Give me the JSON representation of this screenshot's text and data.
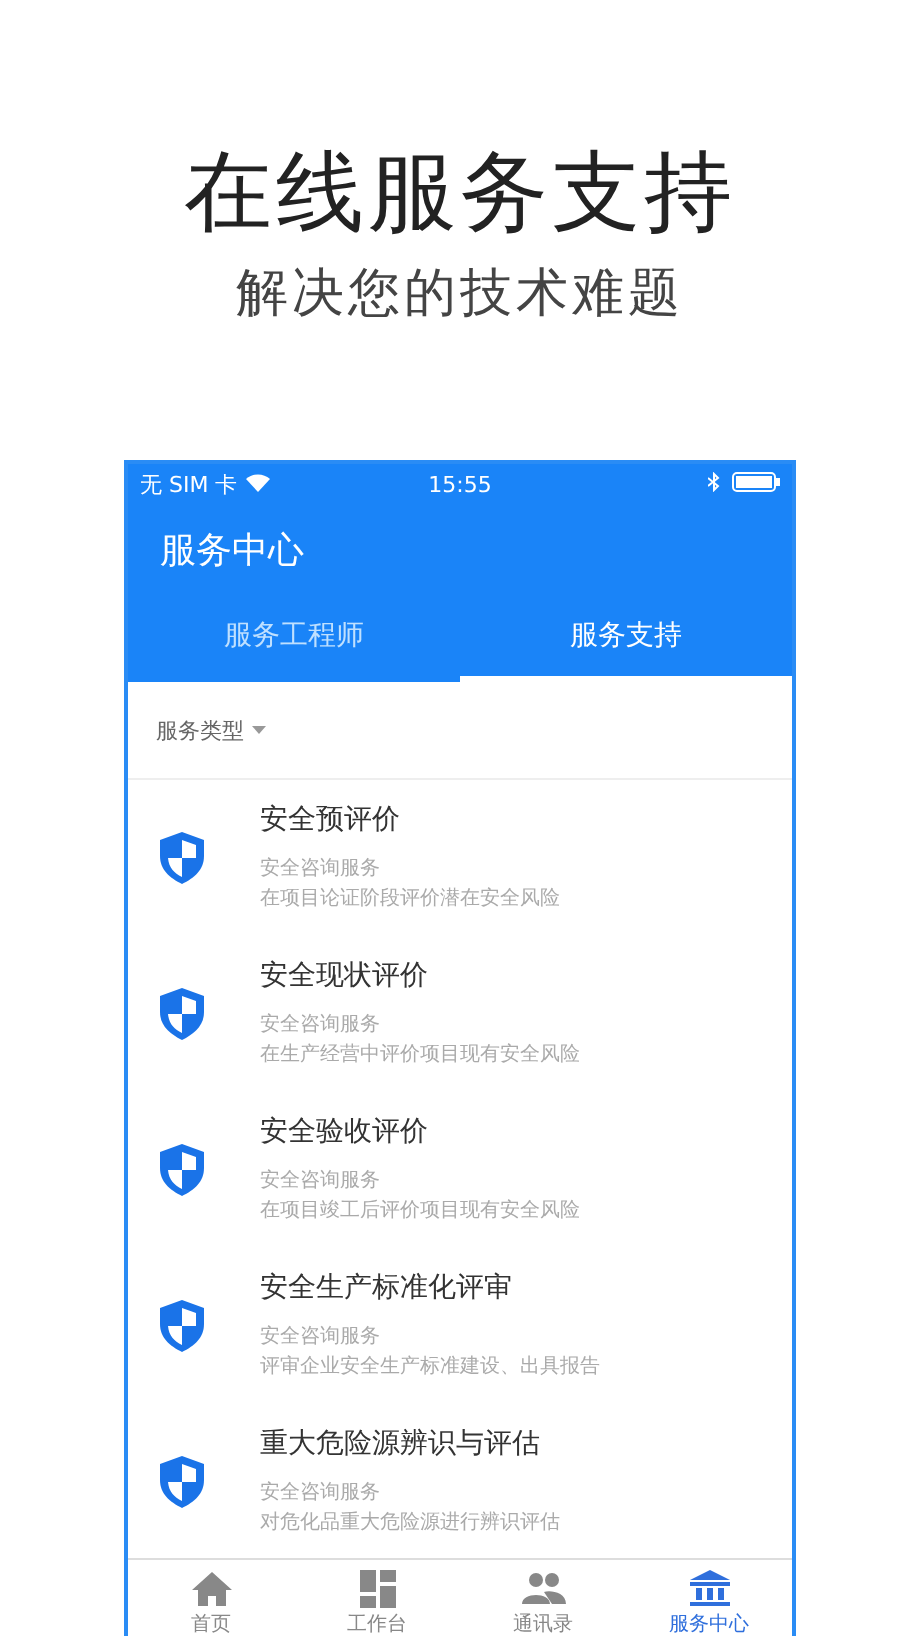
{
  "headline": "在线服务支持",
  "subheadline": "解决您的技术难题",
  "status_bar": {
    "carrier": "无 SIM 卡",
    "time": "15:55"
  },
  "header": {
    "title": "服务中心"
  },
  "tabs": [
    {
      "label": "服务工程师",
      "selected": false
    },
    {
      "label": "服务支持",
      "selected": true
    }
  ],
  "filter": {
    "label": "服务类型"
  },
  "services": [
    {
      "title": "安全预评价",
      "category": "安全咨询服务",
      "description": "在项目论证阶段评价潜在安全风险"
    },
    {
      "title": "安全现状评价",
      "category": "安全咨询服务",
      "description": "在生产经营中评价项目现有安全风险"
    },
    {
      "title": "安全验收评价",
      "category": "安全咨询服务",
      "description": "在项目竣工后评价项目现有安全风险"
    },
    {
      "title": "安全生产标准化评审",
      "category": "安全咨询服务",
      "description": "评审企业安全生产标准建设、出具报告"
    },
    {
      "title": "重大危险源辨识与评估",
      "category": "安全咨询服务",
      "description": "对危化品重大危险源进行辨识评估"
    }
  ],
  "bottom_nav": [
    {
      "kind": "home",
      "label": "首页",
      "selected": false
    },
    {
      "kind": "workbench",
      "label": "工作台",
      "selected": false
    },
    {
      "kind": "contacts",
      "label": "通讯录",
      "selected": false
    },
    {
      "kind": "service",
      "label": "服务中心",
      "selected": true
    }
  ]
}
